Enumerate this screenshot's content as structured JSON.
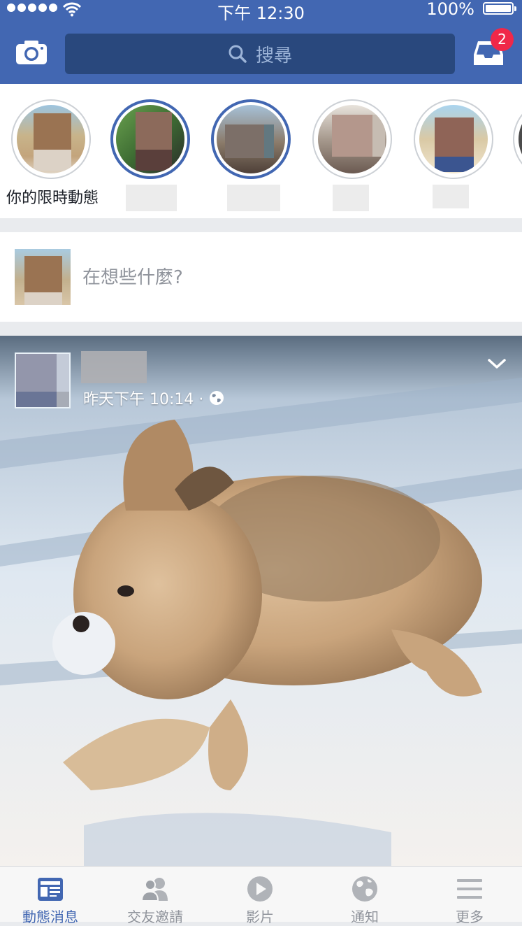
{
  "status_bar": {
    "time": "下午 12:30",
    "battery_percent": "100%",
    "battery_level": 1.0
  },
  "nav": {
    "search_placeholder": "搜尋",
    "inbox_badge": "2",
    "brand_color": "#4267b2"
  },
  "stories": {
    "items": [
      {
        "label": "你的限時動態",
        "seen": true
      },
      {
        "label": "",
        "seen": false
      },
      {
        "label": "",
        "seen": false
      },
      {
        "label": "",
        "seen": true
      },
      {
        "label": "",
        "seen": true
      }
    ]
  },
  "composer": {
    "prompt": "在想些什麼?"
  },
  "post": {
    "timestamp": "昨天下午 10:14 ·",
    "privacy_icon": "globe-icon",
    "menu_icon": "chevron-down-icon"
  },
  "tabbar": {
    "active_color": "#4267b2",
    "inactive_color": "#90949c",
    "tabs": [
      {
        "label": "動態消息",
        "icon": "news-feed-icon",
        "active": true
      },
      {
        "label": "交友邀請",
        "icon": "friend-requests-icon",
        "active": false
      },
      {
        "label": "影片",
        "icon": "video-play-icon",
        "active": false
      },
      {
        "label": "通知",
        "icon": "globe-notifications-icon",
        "active": false
      },
      {
        "label": "更多",
        "icon": "menu-hamburger-icon",
        "active": false
      }
    ]
  }
}
